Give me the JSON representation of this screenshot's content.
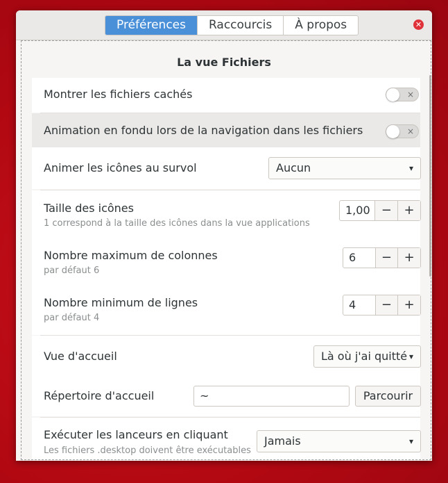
{
  "tabs": [
    "Préférences",
    "Raccourcis",
    "À propos"
  ],
  "close_icon": "close-icon",
  "section_title": "La vue Fichiers",
  "rows": {
    "hidden_files": {
      "label": "Montrer les fichiers cachés",
      "state": "off"
    },
    "fade": {
      "label": "Animation en fondu lors de la navigation dans les fichiers",
      "state": "off"
    },
    "hover_anim": {
      "label": "Animer les icônes au survol",
      "value": "Aucun"
    },
    "icon_size": {
      "label": "Taille des icônes",
      "sub": "1 correspond à la taille des icônes dans la vue applications",
      "value": "1,00"
    },
    "max_cols": {
      "label": "Nombre maximum de colonnes",
      "sub": "par défaut 6",
      "value": "6"
    },
    "min_rows": {
      "label": "Nombre minimum de lignes",
      "sub": "par défaut 4",
      "value": "4"
    },
    "home_view": {
      "label": "Vue d'accueil",
      "value": "Là où j'ai quitté"
    },
    "home_dir": {
      "label": "Répertoire d'accueil",
      "value": "~",
      "button": "Parcourir"
    },
    "launchers": {
      "label": "Exécuter les lanceurs en cliquant",
      "sub": "Les fichiers .desktop doivent être exécutables",
      "value": "Jamais"
    }
  },
  "symbols": {
    "minus": "−",
    "plus": "+",
    "x": "×",
    "chevron": "⌄"
  },
  "colors": {
    "accent": "#4a90d9",
    "close": "#e0323a",
    "background": "#b00812"
  }
}
